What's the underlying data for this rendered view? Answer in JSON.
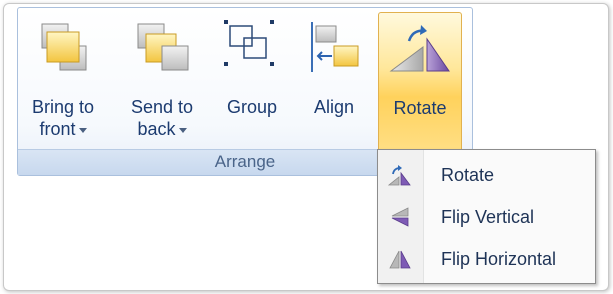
{
  "ribbon": {
    "group_label": "Arrange",
    "buttons": {
      "bring_to_front": {
        "line1": "Bring to",
        "line2": "front"
      },
      "send_to_back": {
        "line1": "Send to",
        "line2": "back"
      },
      "group": {
        "label": "Group"
      },
      "align": {
        "label": "Align"
      },
      "rotate": {
        "label": "Rotate"
      }
    }
  },
  "rotate_menu": {
    "items": [
      {
        "label": "Rotate",
        "icon": "rotate-icon"
      },
      {
        "label": "Flip Vertical",
        "icon": "flip-vertical-icon"
      },
      {
        "label": "Flip Horizontal",
        "icon": "flip-horizontal-icon"
      }
    ]
  },
  "colors": {
    "accent_yellow": "#ffd25c",
    "label_blue": "#1c3b70",
    "group_footer": "#c7d8ee"
  }
}
